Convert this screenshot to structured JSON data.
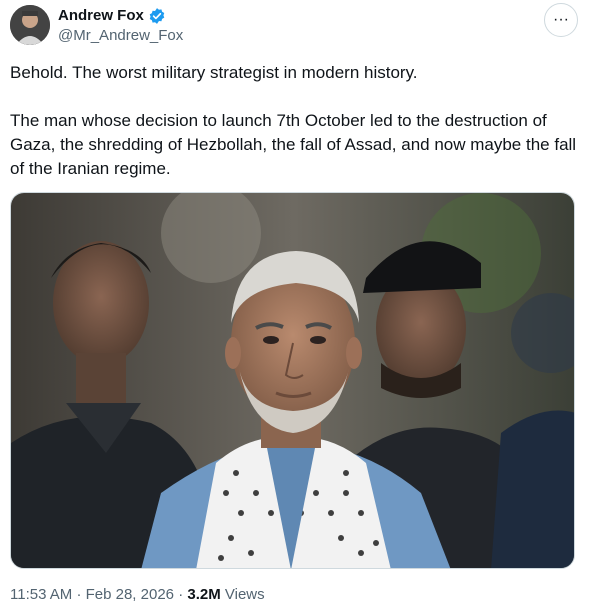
{
  "author": {
    "display_name": "Andrew Fox",
    "handle": "@Mr_Andrew_Fox",
    "verified": true,
    "verified_color": "#1d9bf0"
  },
  "more_button": {
    "icon": "more-horizontal-icon",
    "label": "···"
  },
  "tweet": {
    "paragraphs": [
      "Behold. The worst military strategist in modern history.",
      "The man whose decision to launch 7th October led to the destruction of Gaza, the shredding of Hezbollah, the fall of Assad, and now maybe the fall of the Iranian regime."
    ]
  },
  "meta": {
    "time": "11:53 AM",
    "separator": "·",
    "date": "Feb 28, 2026",
    "views_count": "3.2M",
    "views_label": "Views"
  }
}
